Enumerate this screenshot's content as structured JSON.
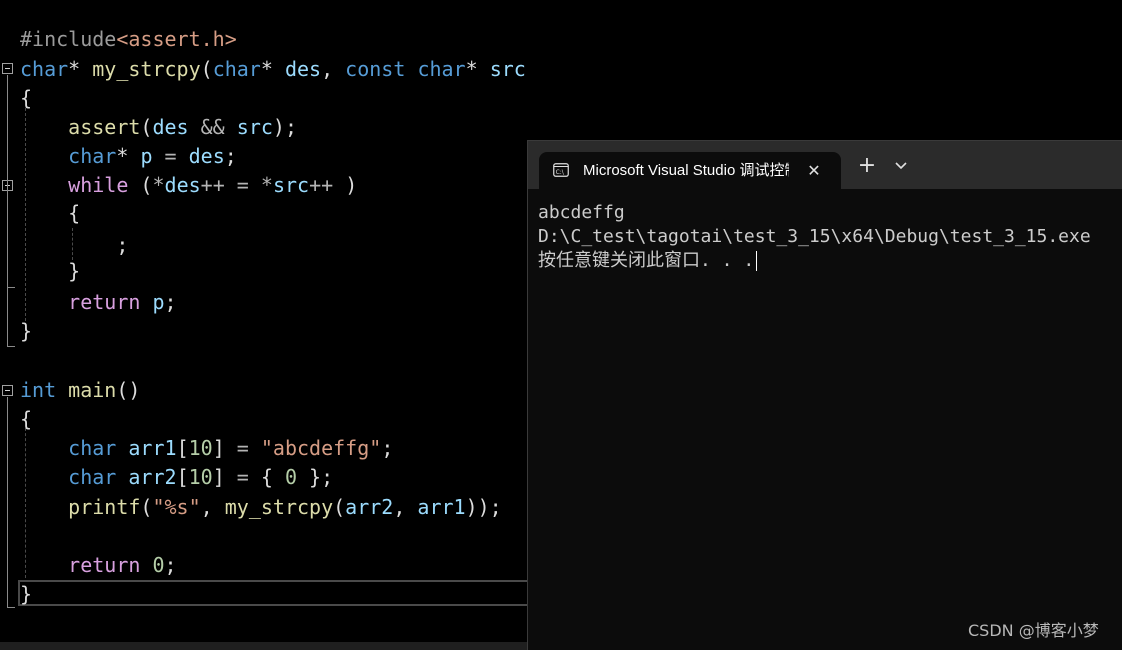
{
  "editor": {
    "lines": [
      {
        "tokens": [
          [
            "pp",
            "#include"
          ],
          [
            "inc",
            "<assert.h>"
          ]
        ]
      },
      {
        "tokens": [
          [
            "kw",
            "char"
          ],
          [
            "pl",
            "* "
          ],
          [
            "fn",
            "my_strcpy"
          ],
          [
            "pl",
            "("
          ],
          [
            "kw",
            "char"
          ],
          [
            "pl",
            "* "
          ],
          [
            "id",
            "des"
          ],
          [
            "pl",
            ", "
          ],
          [
            "kw",
            "const"
          ],
          [
            "pl",
            " "
          ],
          [
            "kw",
            "char"
          ],
          [
            "pl",
            "* "
          ],
          [
            "id",
            "src"
          ],
          [
            "pl",
            ")"
          ]
        ]
      },
      {
        "tokens": [
          [
            "pl",
            "{"
          ]
        ]
      },
      {
        "tokens": [
          [
            "pl",
            "    "
          ],
          [
            "fn",
            "assert"
          ],
          [
            "pl",
            "("
          ],
          [
            "id",
            "des"
          ],
          [
            "pl",
            " "
          ],
          [
            "op",
            "&&"
          ],
          [
            "pl",
            " "
          ],
          [
            "id",
            "src"
          ],
          [
            "pl",
            ");"
          ]
        ]
      },
      {
        "tokens": [
          [
            "pl",
            "    "
          ],
          [
            "kw",
            "char"
          ],
          [
            "pl",
            "* "
          ],
          [
            "id",
            "p"
          ],
          [
            "pl",
            " "
          ],
          [
            "op",
            "="
          ],
          [
            "pl",
            " "
          ],
          [
            "id",
            "des"
          ],
          [
            "pl",
            ";"
          ]
        ]
      },
      {
        "tokens": [
          [
            "pl",
            "    "
          ],
          [
            "ctl",
            "while"
          ],
          [
            "pl",
            " ("
          ],
          [
            "op",
            "*"
          ],
          [
            "id",
            "des"
          ],
          [
            "op",
            "++"
          ],
          [
            "pl",
            " "
          ],
          [
            "op",
            "="
          ],
          [
            "pl",
            " "
          ],
          [
            "op",
            "*"
          ],
          [
            "id",
            "src"
          ],
          [
            "op",
            "++"
          ],
          [
            "pl",
            " )"
          ]
        ]
      },
      {
        "tokens": [
          [
            "pl",
            "    {"
          ]
        ]
      },
      {
        "tokens": [
          [
            "pl",
            "        ;"
          ]
        ]
      },
      {
        "tokens": [
          [
            "pl",
            "    }"
          ]
        ]
      },
      {
        "tokens": [
          [
            "pl",
            "    "
          ],
          [
            "ctl",
            "return"
          ],
          [
            "pl",
            " "
          ],
          [
            "id",
            "p"
          ],
          [
            "pl",
            ";"
          ]
        ]
      },
      {
        "tokens": [
          [
            "pl",
            "}"
          ]
        ]
      },
      {
        "tokens": []
      },
      {
        "tokens": [
          [
            "kw",
            "int"
          ],
          [
            "pl",
            " "
          ],
          [
            "fn",
            "main"
          ],
          [
            "pl",
            "()"
          ]
        ]
      },
      {
        "tokens": [
          [
            "pl",
            "{"
          ]
        ]
      },
      {
        "tokens": [
          [
            "pl",
            "    "
          ],
          [
            "kw",
            "char"
          ],
          [
            "pl",
            " "
          ],
          [
            "id",
            "arr1"
          ],
          [
            "pl",
            "["
          ],
          [
            "num",
            "10"
          ],
          [
            "pl",
            "] "
          ],
          [
            "op",
            "="
          ],
          [
            "pl",
            " "
          ],
          [
            "str",
            "\"abcdeffg\""
          ],
          [
            "pl",
            ";"
          ]
        ]
      },
      {
        "tokens": [
          [
            "pl",
            "    "
          ],
          [
            "kw",
            "char"
          ],
          [
            "pl",
            " "
          ],
          [
            "id",
            "arr2"
          ],
          [
            "pl",
            "["
          ],
          [
            "num",
            "10"
          ],
          [
            "pl",
            "] "
          ],
          [
            "op",
            "="
          ],
          [
            "pl",
            " { "
          ],
          [
            "num",
            "0"
          ],
          [
            "pl",
            " };"
          ]
        ]
      },
      {
        "tokens": [
          [
            "pl",
            "    "
          ],
          [
            "fn",
            "printf"
          ],
          [
            "pl",
            "("
          ],
          [
            "str",
            "\"%s\""
          ],
          [
            "pl",
            ", "
          ],
          [
            "fn",
            "my_strcpy"
          ],
          [
            "pl",
            "("
          ],
          [
            "id",
            "arr2"
          ],
          [
            "pl",
            ", "
          ],
          [
            "id",
            "arr1"
          ],
          [
            "pl",
            "));"
          ]
        ]
      },
      {
        "tokens": []
      },
      {
        "tokens": [
          [
            "pl",
            "    "
          ],
          [
            "ctl",
            "return"
          ],
          [
            "pl",
            " "
          ],
          [
            "num",
            "0"
          ],
          [
            "pl",
            ";"
          ]
        ]
      },
      {
        "tokens": [
          [
            "pl",
            "}"
          ]
        ]
      }
    ]
  },
  "terminal": {
    "tab_title": "Microsoft Visual Studio 调试控制台",
    "icons": {
      "tab": "console-icon",
      "close": "close-icon",
      "new_tab": "plus-icon",
      "dropdown": "chevron-down-icon"
    },
    "output": [
      "abcdeffg",
      "D:\\C_test\\tagotai\\test_3_15\\x64\\Debug\\test_3_15.exe",
      "按任意键关闭此窗口. . ."
    ]
  },
  "watermark": "CSDN @博客小梦",
  "colors": {
    "keyword": "#569cd6",
    "control": "#d8a0df",
    "function": "#dcdcaa",
    "identifier": "#9cdcfe",
    "string": "#d69d85",
    "number": "#b5cea8",
    "plain": "#dcdcdc",
    "terminal_bg": "#0c0c0c",
    "titlebar_bg": "#2b2b2b"
  }
}
